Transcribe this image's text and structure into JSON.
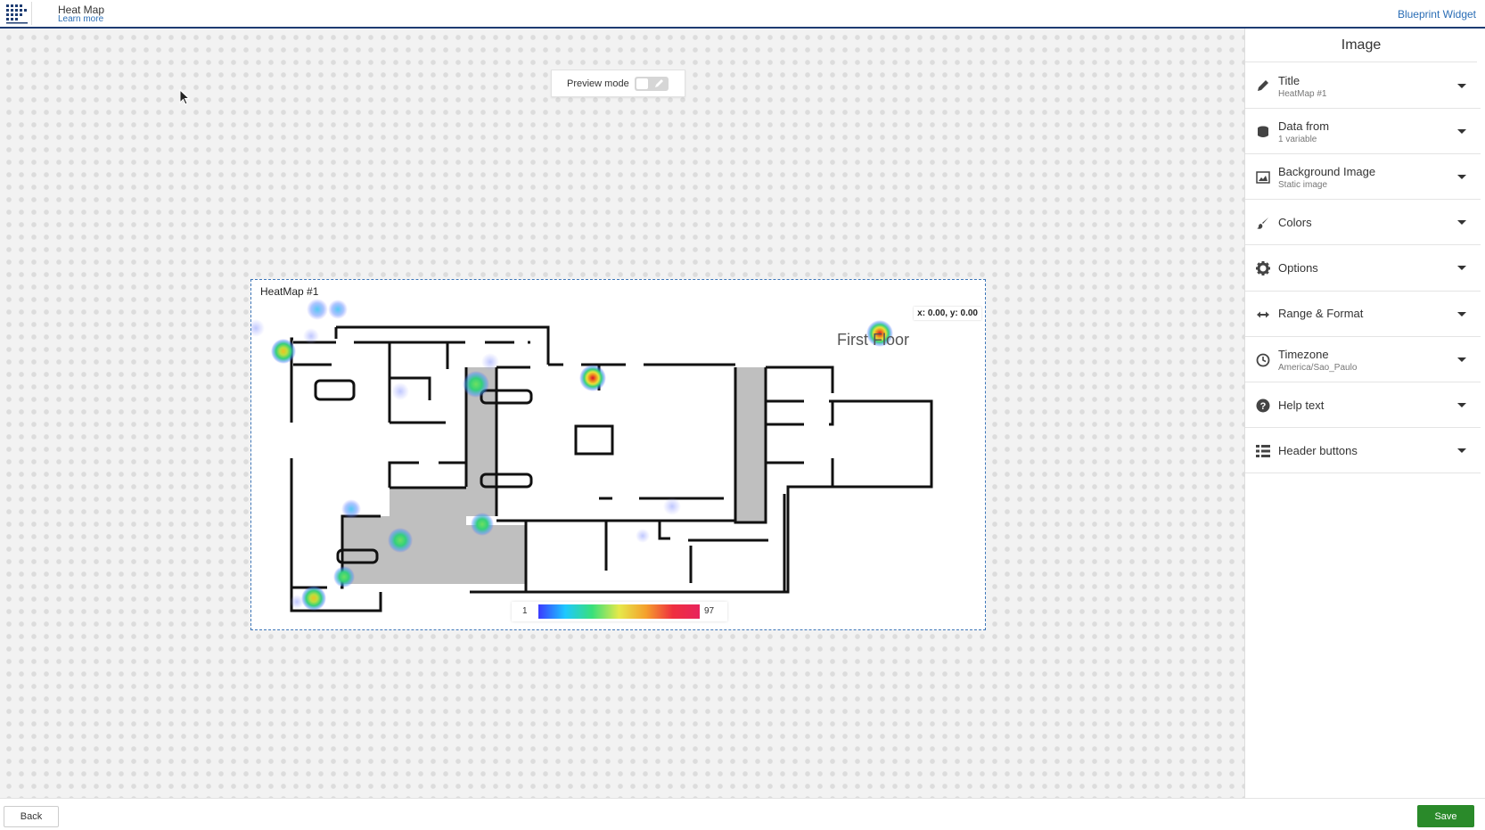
{
  "header": {
    "app_title": "Heat Map",
    "learn_more": "Learn more",
    "blueprint_link": "Blueprint Widget"
  },
  "preview": {
    "label": "Preview mode",
    "enabled": false
  },
  "widget": {
    "title": "HeatMap #1",
    "coords": "x: 0.00, y: 0.00",
    "floor_label": "First Floor",
    "legend_min": "1",
    "legend_max": "97"
  },
  "panel": {
    "title": "Image",
    "items": [
      {
        "label": "Title",
        "sub": "HeatMap #1",
        "icon": "pencil-icon"
      },
      {
        "label": "Data from",
        "sub": "1 variable",
        "icon": "database-icon"
      },
      {
        "label": "Background Image",
        "sub": "Static image",
        "icon": "image-icon"
      },
      {
        "label": "Colors",
        "sub": "",
        "icon": "brush-icon"
      },
      {
        "label": "Options",
        "sub": "",
        "icon": "gear-icon"
      },
      {
        "label": "Range & Format",
        "sub": "",
        "icon": "range-arrows-icon"
      },
      {
        "label": "Timezone",
        "sub": "America/Sao_Paulo",
        "icon": "clock-icon"
      },
      {
        "label": "Help text",
        "sub": "",
        "icon": "question-icon"
      },
      {
        "label": "Header buttons",
        "sub": "",
        "icon": "list-icon"
      }
    ]
  },
  "footer": {
    "back_label": "Back",
    "save_label": "Save"
  },
  "colors": {
    "accent": "#1e3c72",
    "link": "#2a6db5",
    "save": "#2a8a2a",
    "selection": "#3d76b8"
  }
}
